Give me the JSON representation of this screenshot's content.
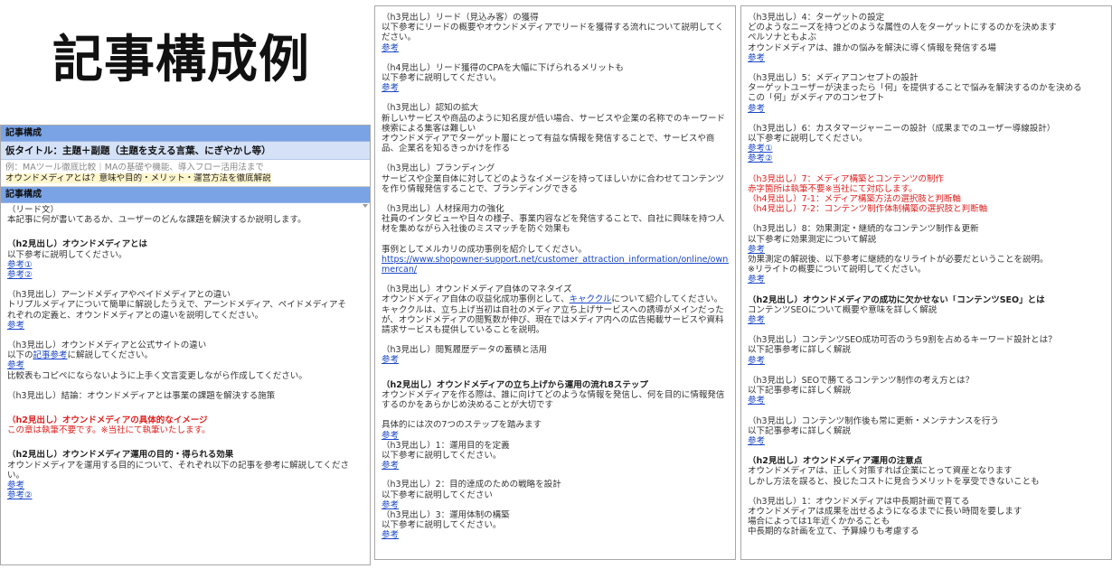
{
  "big_title": "記事構成例",
  "panel1": {
    "bar1": "記事構成",
    "bar2": "仮タイトル：主題＋副題（主題を支える言葉、にぎやかし等）",
    "example_grey": "例：MAツール徹底比較｜MAの基礎や機能、導入フロー活用法まで",
    "example_yellow": "オウンドメディアとは？意味や目的・メリット・運営方法を徹底解説",
    "bar3": "記事構成",
    "lead_heading": "（リード文）",
    "lead_text": "本記事に何が書いてあるか、ユーザーのどんな課題を解決するか説明します。",
    "s1_title": "（h2見出し）オウンドメディアとは",
    "s1_text": "以下参考に説明してください。",
    "s1_link1": "参考①",
    "s1_link2": "参考②",
    "s2_title": "（h3見出し）アーンドメディアやペイドメディアとの違い",
    "s2_text1": "トリプルメディアについて簡単に解説したうえで、アーンドメディア、ペイドメディアそ",
    "s2_text2": "れぞれの定義と、オウンドメディアとの違いを説明してください。",
    "s2_link": "参考",
    "s3_title": "（h3見出し）オウンドメディアと公式サイトの違い",
    "s3_text_pre": "以下の",
    "s3_text_link": "記事参考",
    "s3_text_post": "に解説してください。",
    "s3_link": "参考",
    "s3_note": "比較表もコピペにならないように上手く文言変更しながら作成してください。",
    "s4_title": "（h3見出し）結論：オウンドメディアとは事業の課題を解決する施策",
    "s5_title": "（h2見出し）オウンドメディアの具体的なイメージ",
    "s5_text": "この章は執筆不要です。※当社にて執筆いたします。",
    "s6_title": "（h2見出し）オウンドメディア運用の目的・得られる効果",
    "s6_text1": "オウンドメディアを運用する目的について、それぞれ以下の記事を参考に解説してくださ",
    "s6_text2": "い。",
    "s6_link1": "参考",
    "s6_link2": "参考②"
  },
  "panel2": {
    "a_title": "（h3見出し）リード（見込み客）の獲得",
    "a_text1": "以下参考にリードの概要やオウンドメディアでリードを獲得する流れについて説明してく",
    "a_text2": "ださい。",
    "a_link": "参考",
    "b_title": "（h4見出し）リード獲得のCPAを大幅に下げられるメリットも",
    "b_text": "以下参考に説明してください。",
    "b_link": "参考",
    "c_title": "（h3見出し）認知の拡大",
    "c_text1": "新しいサービスや商品のように知名度が低い場合、サービスや企業の名称でのキーワード",
    "c_text2": "検索による集客は難しい",
    "c_text3": "オウンドメディアでターゲット層にとって有益な情報を発信することで、サービスや商",
    "c_text4": "品、企業名を知るきっかけを作る",
    "d_title": "（h3見出し）ブランディング",
    "d_text1": "サービスや企業自体に対してどのようなイメージを持ってほしいかに合わせてコンテンツ",
    "d_text2": "を作り情報発信することで、ブランディングできる",
    "e_title": "（h3見出し）人材採用力の強化",
    "e_text1": "社員のインタビューや日々の様子、事業内容などを発信することで、自社に興味を持つ人",
    "e_text2": "材を集めながら入社後のミスマッチを防ぐ効果も",
    "f_text": "事例としてメルカリの成功事例を紹介してください。",
    "f_url1": "https://www.shopowner-support.net/customer_attraction_information/online/ownedmedia/",
    "f_url2": "mercan/",
    "g_title": "（h3見出し）オウンドメディア自体のマネタイズ",
    "g_text1_pre": "オウンドメディア自体の収益化成功事例として、",
    "g_text1_link": "キャククル",
    "g_text1_post": "について紹介してください。",
    "g_text2": "キャククルは、立ち上げ当初は自社のメディア立ち上げサービスへの誘導がメインだった",
    "g_text3": "が、オウンドメディアの閲覧数が伸び、現在ではメディア内への広告掲載サービスや資料",
    "g_text4": "請求サービスも提供していることを説明。",
    "h_title": "（h3見出し）閲覧履歴データの蓄積と活用",
    "h_link": "参考",
    "i_title": "（h2見出し）オウンドメディアの立ち上げから運用の流れ8ステップ",
    "i_text1": "オウンドメディアを作る際は、誰に向けてどのような情報を発信し、何を目的に情報発信",
    "i_text2": "するのかをあらかじめ決めることが大切です",
    "j_text": "具体的には次の7つのステップを踏みます",
    "j_link": "参考",
    "k_title": "（h3見出し）1：運用目的を定義",
    "k_text": "以下参考に説明してください。",
    "k_link": "参考",
    "l_title": "（h3見出し）2：目的達成のための戦略を設計",
    "l_text": "以下参考に説明してください",
    "l_link": "参考",
    "m_title": "（h3見出し）3：運用体制の構築",
    "m_text": "以下参考に説明してください。",
    "m_link": "参考"
  },
  "panel3": {
    "a_title": "（h3見出し）4：ターゲットの設定",
    "a_text1": "どのようなニーズを持つどのような属性の人をターゲットにするのかを決めます",
    "a_text2": "ペルソナともよぶ",
    "a_text3": "オウンドメディアは、誰かの悩みを解決に導く情報を発信する場",
    "a_link": "参考",
    "b_title": "（h3見出し）5：メディアコンセプトの設計",
    "b_text1": "ターゲットユーザーが決まったら「何」を提供することで悩みを解決するのかを決める",
    "b_text2": "この「何」がメディアのコンセプト",
    "b_link": "参考",
    "c_title": "（h3見出し）6：カスタマージャーニーの設計（成果までのユーザー導線設計）",
    "c_text": "以下参考に説明してください。",
    "c_link1": "参考①",
    "c_link2": "参考②",
    "d_title": "（h3見出し）7：メディア構築とコンテンツの制作",
    "d_text": "赤字箇所は執筆不要※当社にて対応します。",
    "d_sub1": "（h4見出し）7-1：メディア構築方法の選択肢と判断軸",
    "d_sub2": "（h4見出し）7-2：コンテンツ制作体制構築の選択肢と判断軸",
    "e_title": "（h3見出し）8：効果測定・継続的なコンテンツ制作＆更新",
    "e_text": "以下参考に効果測定について解説",
    "e_link": "参考",
    "e_text2": "効果測定の解説後、以下参考に継続的なリライトが必要だということを説明。",
    "e_text3": "※リライトの概要について説明してください。",
    "e_link2": "参考",
    "f_title": "（h2見出し）オウンドメディアの成功に欠かせない「コンテンツSEO」とは",
    "f_text": "コンテンツSEOについて概要や意味を詳しく解説",
    "f_link": "参考",
    "g_title": "（h3見出し）コンテンツSEO成功可否のうち9割を占めるキーワード設計とは？",
    "g_text": "以下記事参考に詳しく解説",
    "g_link": "参考",
    "h_title": "（h3見出し）SEOで勝てるコンテンツ制作の考え方とは？",
    "h_text": "以下記事参考に詳しく解説",
    "h_link": "参考",
    "i_title": "（h3見出し）コンテンツ制作後も常に更新・メンテナンスを行う",
    "i_text": "以下記事参考に詳しく解説",
    "i_link": "参考",
    "j_title": "（h2見出し）オウンドメディア運用の注意点",
    "j_text1": "オウンドメディアは、正しく対策すれば企業にとって資産となります",
    "j_text2": "しかし方法を誤ると、投じたコストに見合うメリットを享受できないことも",
    "k_title": "（h3見出し）1：オウンドメディアは中長期計画で育てる",
    "k_text1": "オウンドメディアは成果を出せるようになるまでに長い時間を要します",
    "k_text2": "場合によっては1年近くかかることも",
    "k_text3": "中長期的な計画を立て、予算繰りも考慮する"
  }
}
